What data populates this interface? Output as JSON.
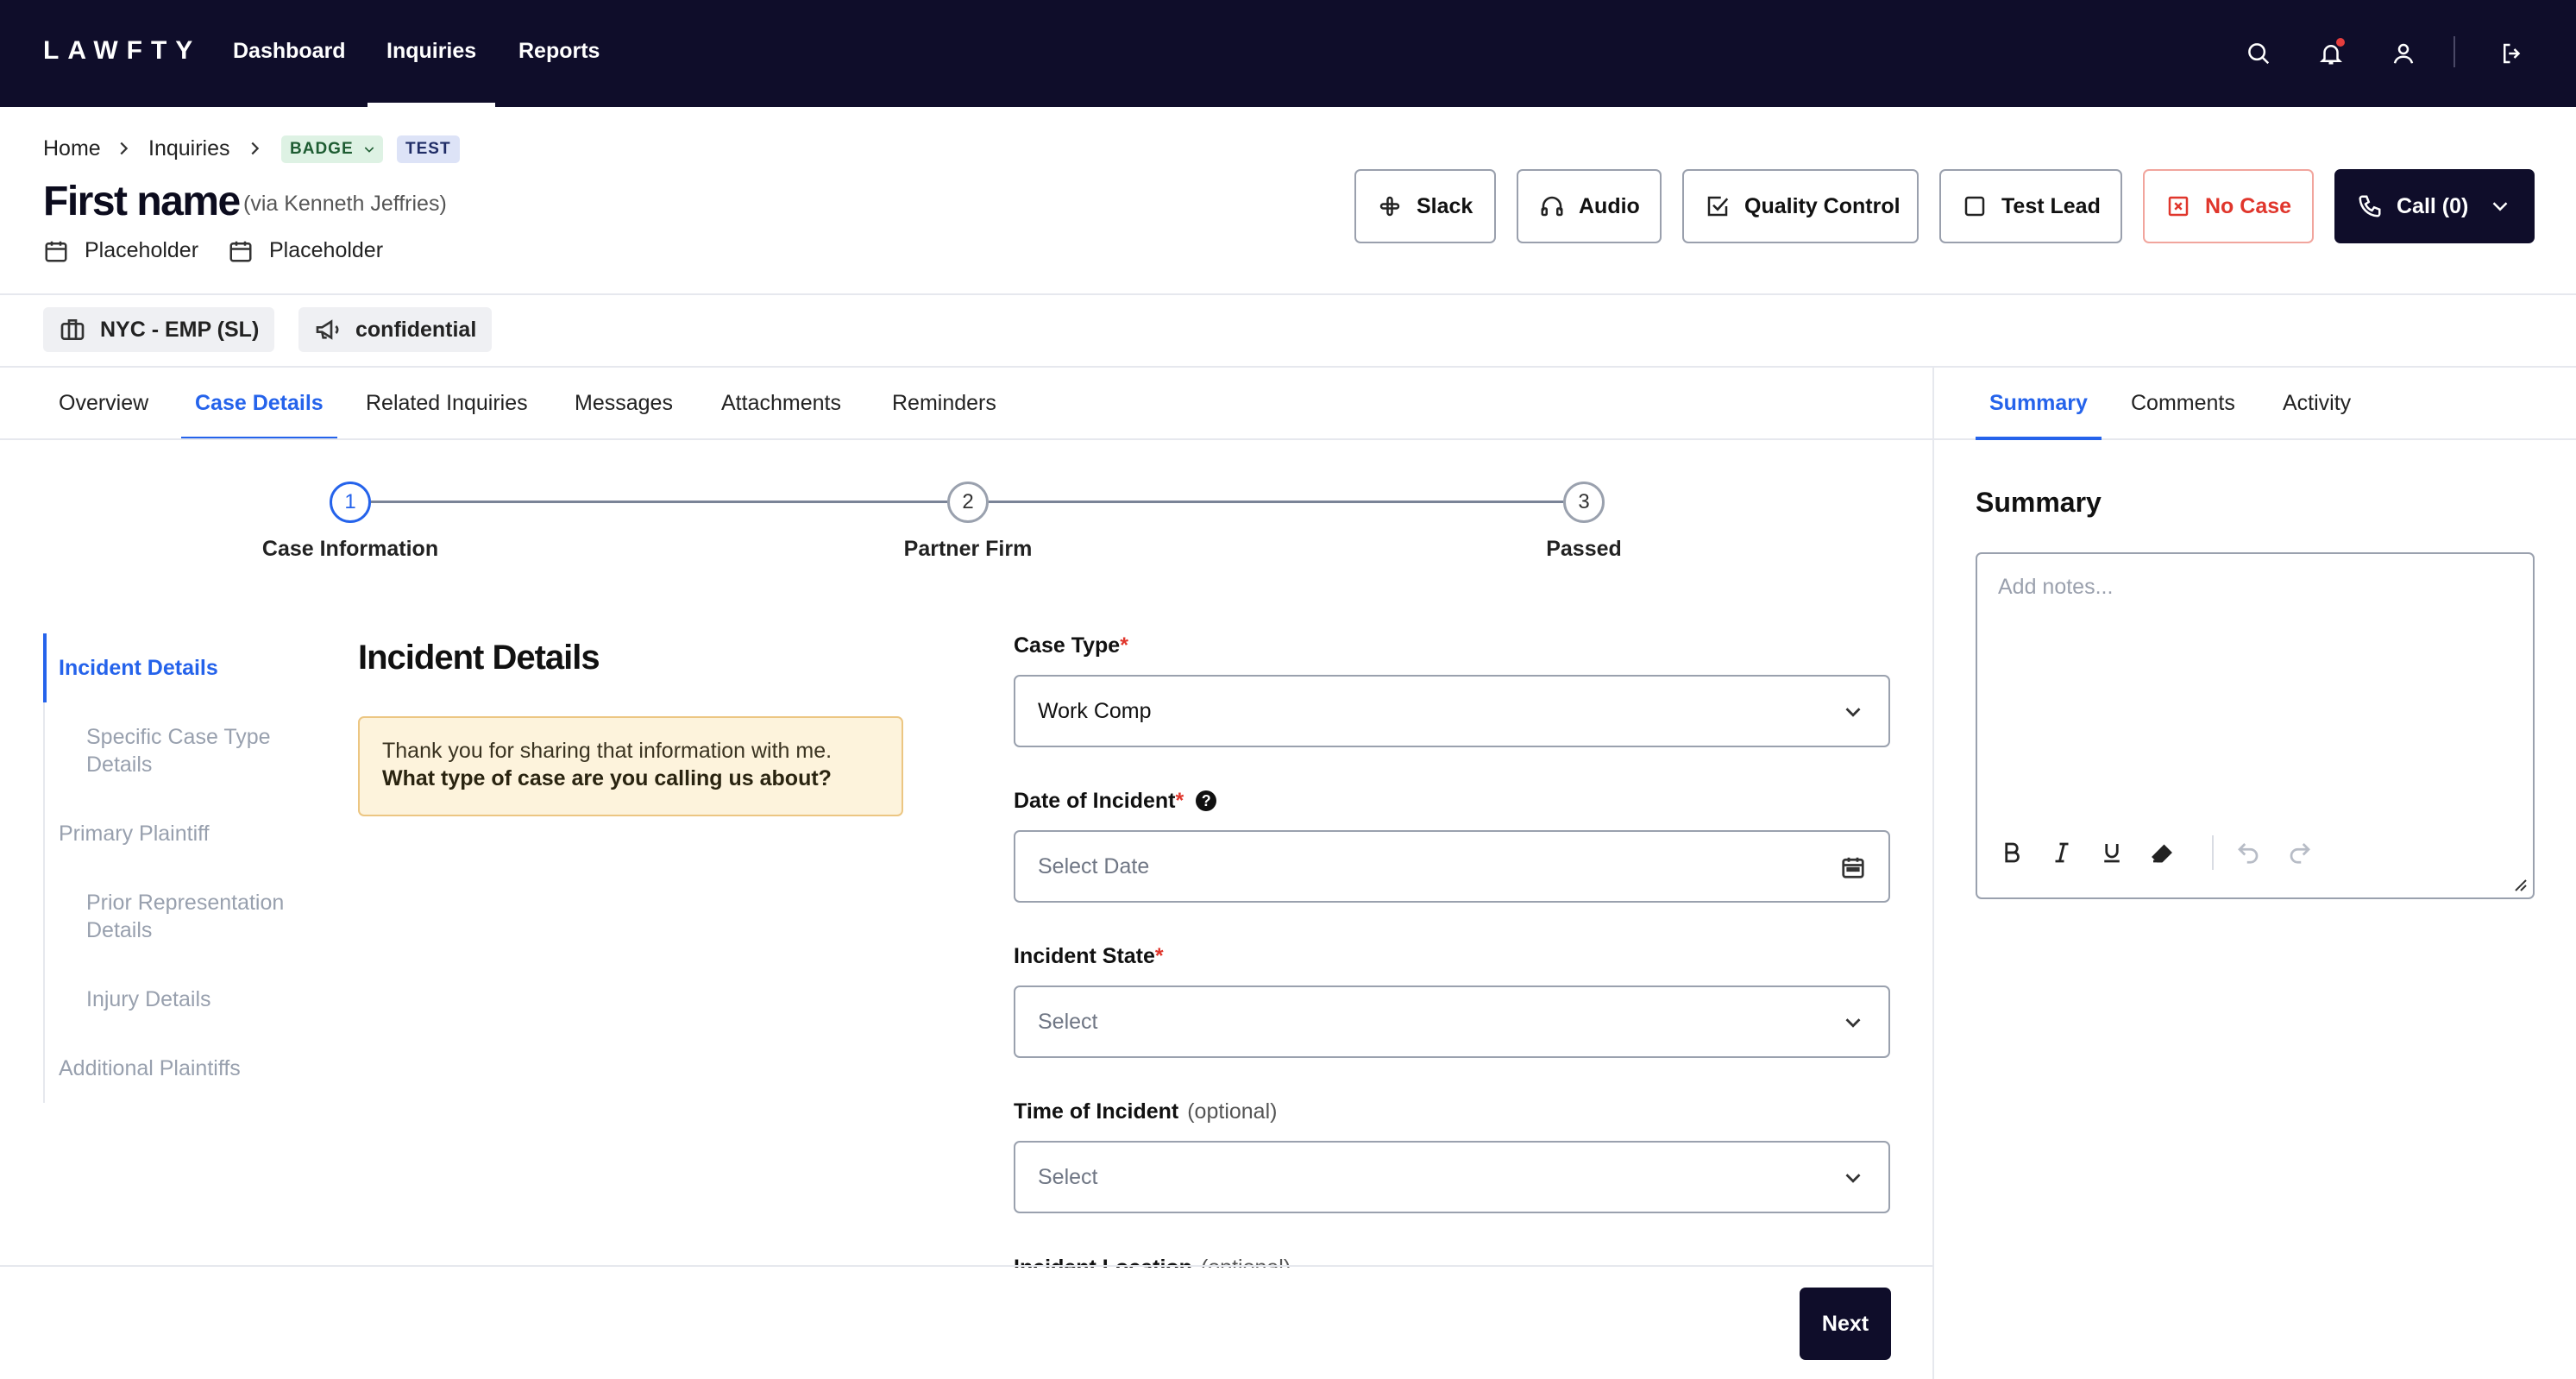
{
  "app": {
    "logo": "LAWFTY"
  },
  "topnav": [
    {
      "label": "Dashboard",
      "active": false
    },
    {
      "label": "Inquiries",
      "active": true
    },
    {
      "label": "Reports",
      "active": false
    }
  ],
  "top_icons": [
    "search-icon",
    "bell-icon",
    "user-icon",
    "logout-icon"
  ],
  "breadcrumb": {
    "home": "Home",
    "inquiries": "Inquiries",
    "badge": "BADGE",
    "test_badge": "TEST"
  },
  "header": {
    "title": "First name",
    "via": "(via Kenneth Jeffries)",
    "meta1": "Placeholder",
    "meta2": "Placeholder"
  },
  "actions": {
    "slack": "Slack",
    "audio": "Audio",
    "quality_control": "Quality Control",
    "test_lead": "Test Lead",
    "no_case": "No Case",
    "call": "Call (0)"
  },
  "tags": {
    "office": "NYC - EMP (SL)",
    "confidential": "confidential"
  },
  "tabs": [
    "Overview",
    "Case Details",
    "Related Inquiries",
    "Messages",
    "Attachments",
    "Reminders"
  ],
  "active_tab": "Case Details",
  "stepper": [
    {
      "num": "1",
      "label": "Case Information",
      "active": true
    },
    {
      "num": "2",
      "label": "Partner Firm",
      "active": false
    },
    {
      "num": "3",
      "label": "Passed",
      "active": false
    }
  ],
  "section_nav": [
    {
      "label": "Incident Details",
      "active": true
    },
    {
      "label": "Specific Case Type Details",
      "active": false
    },
    {
      "label": "Primary Plaintiff",
      "active": false
    },
    {
      "label": "Prior Representation Details",
      "active": false
    },
    {
      "label": "Injury Details",
      "active": false
    },
    {
      "label": "Additional Plaintiffs",
      "active": false
    }
  ],
  "section": {
    "title": "Incident Details",
    "callout_line1": "Thank you for sharing that information with me.",
    "callout_line2": "What type of case are you calling us about?"
  },
  "form": {
    "case_type_label": "Case Type",
    "case_type_value": "Work Comp",
    "date_label": "Date of Incident",
    "date_placeholder": "Select Date",
    "state_label": "Incident State",
    "state_placeholder": "Select",
    "time_label": "Time of Incident",
    "time_optional": "(optional)",
    "time_placeholder": "Select",
    "location_label": "Incident Location",
    "location_optional": "(optional)",
    "required_mark": "*",
    "help": "?"
  },
  "footer": {
    "next": "Next"
  },
  "right_panel": {
    "tabs": [
      "Summary",
      "Comments",
      "Activity"
    ],
    "active_tab": "Summary",
    "title": "Summary",
    "placeholder": "Add notes..."
  },
  "colors": {
    "navy": "#0f0d2a",
    "accent": "#2563eb",
    "danger": "#e0362c",
    "callout_bg": "#fdf3dc"
  }
}
